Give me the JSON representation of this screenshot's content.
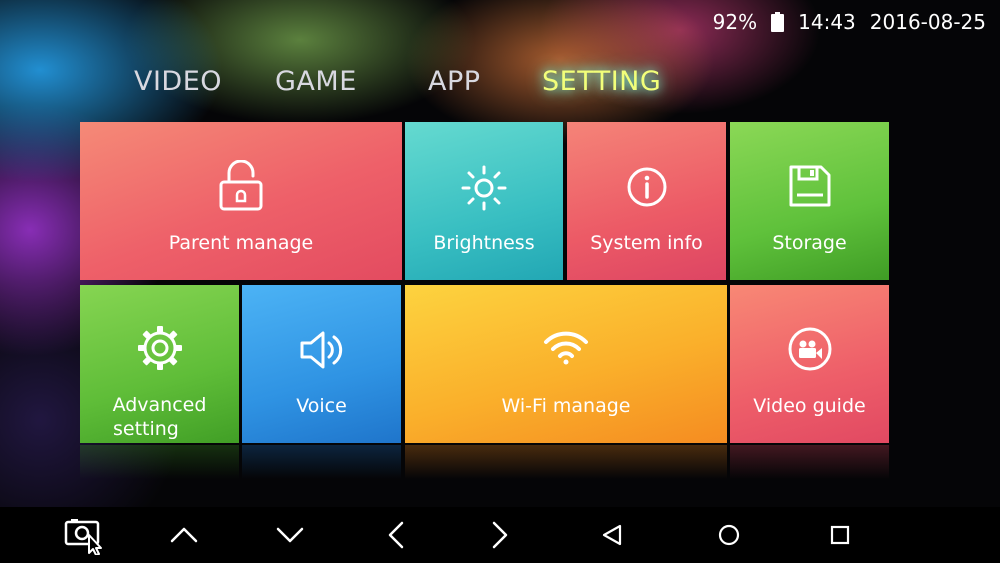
{
  "status": {
    "battery_percent": "92%",
    "time": "14:43",
    "date": "2016-08-25",
    "battery_icon": "battery-icon"
  },
  "tabs": [
    {
      "label": "VIDEO",
      "active": false
    },
    {
      "label": "GAME",
      "active": false
    },
    {
      "label": "APP",
      "active": false
    },
    {
      "label": "SETTING",
      "active": true
    }
  ],
  "tiles": {
    "parent_manage": {
      "label": "Parent manage",
      "icon": "unlock-icon",
      "color": "#ee6069"
    },
    "brightness": {
      "label": "Brightness",
      "icon": "sun-icon",
      "color": "#39bfc2"
    },
    "system_info": {
      "label": "System info",
      "icon": "info-icon",
      "color": "#ec5a66"
    },
    "storage": {
      "label": "Storage",
      "icon": "floppy-disk-icon",
      "color": "#5fc13b"
    },
    "advanced_setting": {
      "label_line1": "Advanced",
      "label_line2": "setting",
      "icon": "gear-icon",
      "color": "#5fbd38"
    },
    "voice": {
      "label": "Voice",
      "icon": "speaker-icon",
      "color": "#2f93e3"
    },
    "wifi_manage": {
      "label": "Wi-Fi manage",
      "icon": "wifi-icon",
      "color": "#fab02b"
    },
    "video_guide": {
      "label": "Video guide",
      "icon": "video-camera-icon",
      "color": "#ee5e69"
    }
  },
  "navbar": [
    {
      "icon": "screenshot-icon"
    },
    {
      "icon": "chevron-up-icon"
    },
    {
      "icon": "chevron-down-icon"
    },
    {
      "icon": "chevron-left-icon"
    },
    {
      "icon": "chevron-right-icon"
    },
    {
      "icon": "back-triangle-icon"
    },
    {
      "icon": "home-circle-icon"
    },
    {
      "icon": "recents-square-icon"
    }
  ],
  "colors": {
    "active_tab": "#f2ff7a",
    "inactive_tab": "#d8d8e0"
  }
}
